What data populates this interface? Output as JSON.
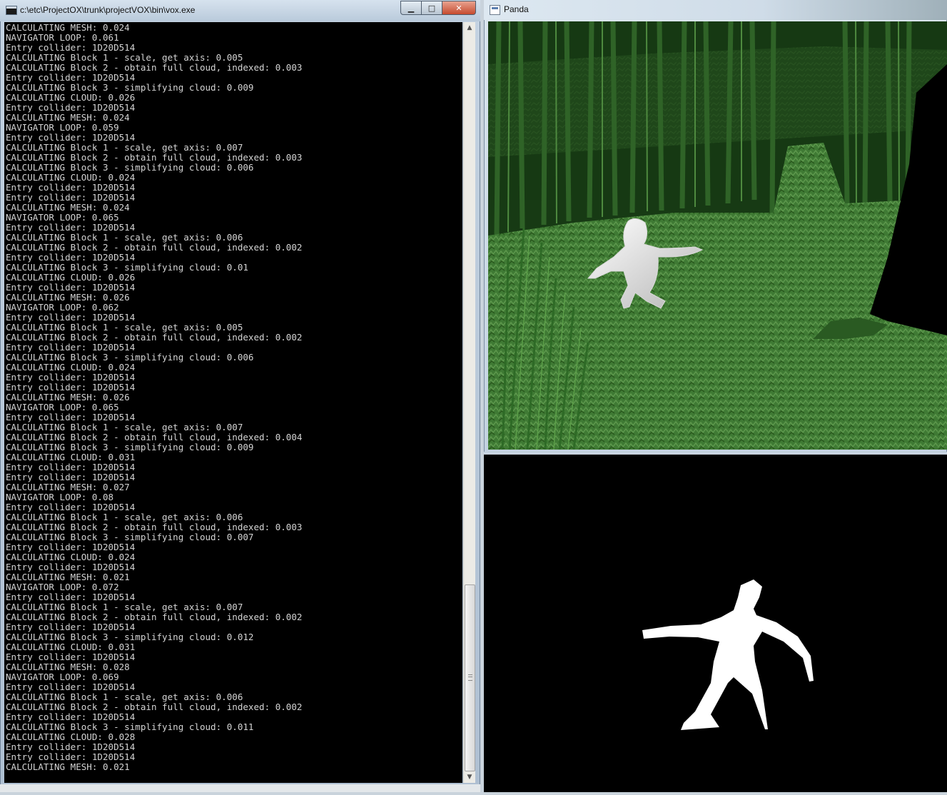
{
  "console_window": {
    "title": "c:\\etc\\ProjectOX\\trunk\\projectVOX\\bin\\vox.exe",
    "minimize_symbol": "▁",
    "maximize_symbol": "□",
    "close_symbol": "✕",
    "lines": [
      "CALCULATING MESH: 0.024",
      "NAVIGATOR LOOP: 0.061",
      "Entry collider: 1D20D514",
      "CALCULATING Block 1 - scale, get axis: 0.005",
      "CALCULATING Block 2 - obtain full cloud, indexed: 0.003",
      "Entry collider: 1D20D514",
      "CALCULATING Block 3 - simplifying cloud: 0.009",
      "CALCULATING CLOUD: 0.026",
      "Entry collider: 1D20D514",
      "CALCULATING MESH: 0.024",
      "NAVIGATOR LOOP: 0.059",
      "Entry collider: 1D20D514",
      "CALCULATING Block 1 - scale, get axis: 0.007",
      "CALCULATING Block 2 - obtain full cloud, indexed: 0.003",
      "CALCULATING Block 3 - simplifying cloud: 0.006",
      "CALCULATING CLOUD: 0.024",
      "Entry collider: 1D20D514",
      "Entry collider: 1D20D514",
      "CALCULATING MESH: 0.024",
      "NAVIGATOR LOOP: 0.065",
      "Entry collider: 1D20D514",
      "CALCULATING Block 1 - scale, get axis: 0.006",
      "CALCULATING Block 2 - obtain full cloud, indexed: 0.002",
      "Entry collider: 1D20D514",
      "CALCULATING Block 3 - simplifying cloud: 0.01",
      "CALCULATING CLOUD: 0.026",
      "Entry collider: 1D20D514",
      "CALCULATING MESH: 0.026",
      "NAVIGATOR LOOP: 0.062",
      "Entry collider: 1D20D514",
      "CALCULATING Block 1 - scale, get axis: 0.005",
      "CALCULATING Block 2 - obtain full cloud, indexed: 0.002",
      "Entry collider: 1D20D514",
      "CALCULATING Block 3 - simplifying cloud: 0.006",
      "CALCULATING CLOUD: 0.024",
      "Entry collider: 1D20D514",
      "Entry collider: 1D20D514",
      "CALCULATING MESH: 0.026",
      "NAVIGATOR LOOP: 0.065",
      "Entry collider: 1D20D514",
      "CALCULATING Block 1 - scale, get axis: 0.007",
      "CALCULATING Block 2 - obtain full cloud, indexed: 0.004",
      "CALCULATING Block 3 - simplifying cloud: 0.009",
      "CALCULATING CLOUD: 0.031",
      "Entry collider: 1D20D514",
      "Entry collider: 1D20D514",
      "CALCULATING MESH: 0.027",
      "NAVIGATOR LOOP: 0.08",
      "Entry collider: 1D20D514",
      "CALCULATING Block 1 - scale, get axis: 0.006",
      "CALCULATING Block 2 - obtain full cloud, indexed: 0.003",
      "CALCULATING Block 3 - simplifying cloud: 0.007",
      "Entry collider: 1D20D514",
      "CALCULATING CLOUD: 0.024",
      "Entry collider: 1D20D514",
      "CALCULATING MESH: 0.021",
      "NAVIGATOR LOOP: 0.072",
      "Entry collider: 1D20D514",
      "CALCULATING Block 1 - scale, get axis: 0.007",
      "CALCULATING Block 2 - obtain full cloud, indexed: 0.002",
      "Entry collider: 1D20D514",
      "CALCULATING Block 3 - simplifying cloud: 0.012",
      "CALCULATING CLOUD: 0.031",
      "Entry collider: 1D20D514",
      "CALCULATING MESH: 0.028",
      "NAVIGATOR LOOP: 0.069",
      "Entry collider: 1D20D514",
      "CALCULATING Block 1 - scale, get axis: 0.006",
      "CALCULATING Block 2 - obtain full cloud, indexed: 0.002",
      "Entry collider: 1D20D514",
      "CALCULATING Block 3 - simplifying cloud: 0.011",
      "CALCULATING CLOUD: 0.028",
      "Entry collider: 1D20D514",
      "Entry collider: 1D20D514",
      "CALCULATING MESH: 0.021"
    ]
  },
  "panda_window": {
    "title": "Panda"
  },
  "colors": {
    "console_bg": "#000000",
    "console_text": "#d4d4d4",
    "grass": "#3f7a34",
    "bamboo": "#1d4a1a",
    "silhouette": "#ffffff"
  }
}
